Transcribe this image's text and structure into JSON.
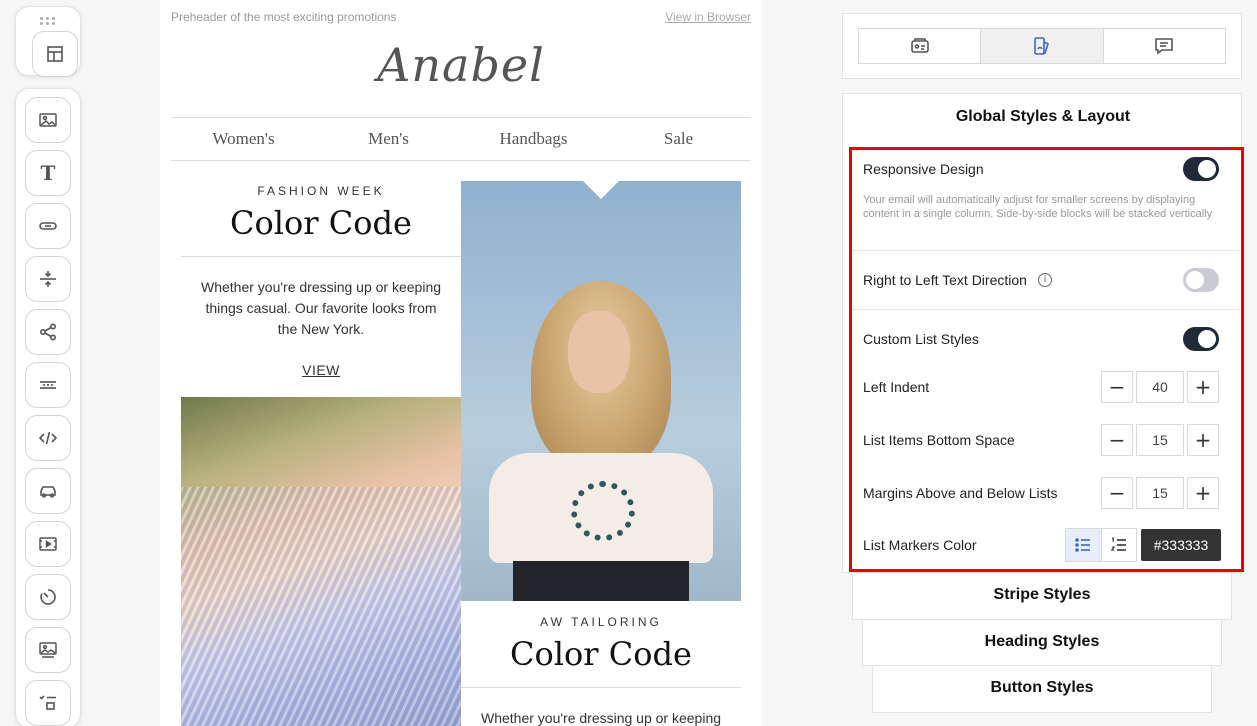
{
  "toolbar": {
    "blocks": [
      {
        "name": "image-block-icon"
      },
      {
        "name": "text-block-icon",
        "glyph": "T"
      },
      {
        "name": "button-block-icon"
      },
      {
        "name": "spacer-block-icon"
      },
      {
        "name": "social-block-icon"
      },
      {
        "name": "banner-block-icon"
      },
      {
        "name": "html-block-icon"
      },
      {
        "name": "menu-block-icon"
      },
      {
        "name": "video-block-icon"
      },
      {
        "name": "timer-block-icon"
      },
      {
        "name": "image-gallery-icon"
      },
      {
        "name": "checklist-icon"
      }
    ],
    "top_icon": "structures-icon"
  },
  "email": {
    "preheader": "Preheader of the most exciting promotions",
    "view_in_browser": "View in Browser",
    "logo": "Anabel",
    "nav": [
      "Women's",
      "Men's",
      "Handbags",
      "Sale"
    ],
    "left_column": {
      "kicker": "FASHION WEEK",
      "headline": "Color Code",
      "body": "Whether you're dressing up or keeping things casual. Our favorite looks from the New York.",
      "link": "VIEW"
    },
    "right_column": {
      "kicker": "AW TAILORING",
      "headline": "Color Code",
      "body_partial": "Whether you're dressing up or keeping"
    }
  },
  "panel": {
    "tabs": [
      {
        "name": "settings-tab-icon",
        "active": false
      },
      {
        "name": "styles-tab-icon",
        "active": true
      },
      {
        "name": "comments-tab-icon",
        "active": false
      }
    ],
    "global_title": "Global Styles & Layout",
    "responsive": {
      "label": "Responsive Design",
      "enabled": true,
      "help": "Your email will automatically adjust for smaller screens by displaying content in a single column. Side-by-side blocks will be stacked vertically"
    },
    "rtl": {
      "label": "Right to Left Text Direction",
      "enabled": false,
      "info_icon": "i"
    },
    "custom_lists": {
      "label": "Custom List Styles",
      "enabled": true
    },
    "left_indent": {
      "label": "Left Indent",
      "value": "40",
      "minus": "−",
      "plus": "+"
    },
    "list_bottom_space": {
      "label": "List Items Bottom Space",
      "value": "15",
      "minus": "−",
      "plus": "+"
    },
    "list_margins": {
      "label": "Margins Above and Below Lists",
      "value": "15",
      "minus": "−",
      "plus": "+"
    },
    "marker_color": {
      "label": "List Markers Color",
      "color": "#333333",
      "selected_marker": "bulleted"
    },
    "collapsed_sections": [
      "Stripe Styles",
      "Heading Styles",
      "Button Styles"
    ]
  }
}
